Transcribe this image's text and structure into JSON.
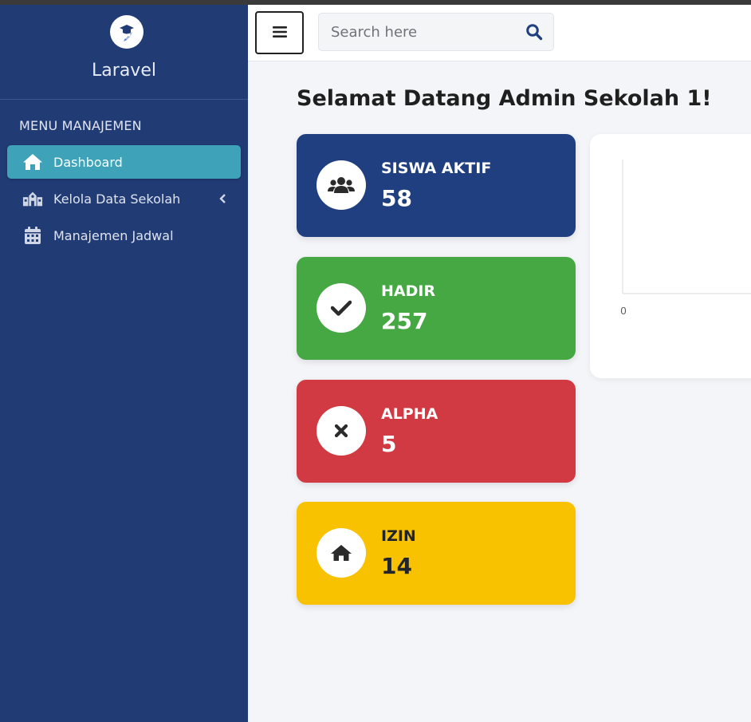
{
  "brand": {
    "name": "Laravel"
  },
  "sidebar": {
    "menu_header": "MENU MANAJEMEN",
    "items": [
      {
        "label": "Dashboard",
        "icon": "home-icon",
        "active": true
      },
      {
        "label": "Kelola Data Sekolah",
        "icon": "school-icon",
        "active": false
      },
      {
        "label": "Manajemen Jadwal",
        "icon": "calendar-icon",
        "active": false
      }
    ]
  },
  "topbar": {
    "search_placeholder": "Search here"
  },
  "main": {
    "title": "Selamat Datang Admin Sekolah 1!",
    "stats": [
      {
        "label": "SISWA AKTIF",
        "value": "58",
        "icon": "users-icon",
        "color": "#1f3f80",
        "text_color": "#ffffff"
      },
      {
        "label": "HADIR",
        "value": "257",
        "icon": "check-icon",
        "color": "#45a843",
        "text_color": "#ffffff"
      },
      {
        "label": "ALPHA",
        "value": "5",
        "icon": "times-icon",
        "color": "#d13a43",
        "text_color": "#ffffff"
      },
      {
        "label": "IZIN",
        "value": "14",
        "icon": "home-icon",
        "color": "#f8c200",
        "text_color": "#212529"
      }
    ]
  },
  "chart_data": {
    "type": "bar",
    "categories": [],
    "values": [],
    "x_tick_labels": [
      "0"
    ],
    "title": "",
    "xlabel": "",
    "ylabel": ""
  }
}
